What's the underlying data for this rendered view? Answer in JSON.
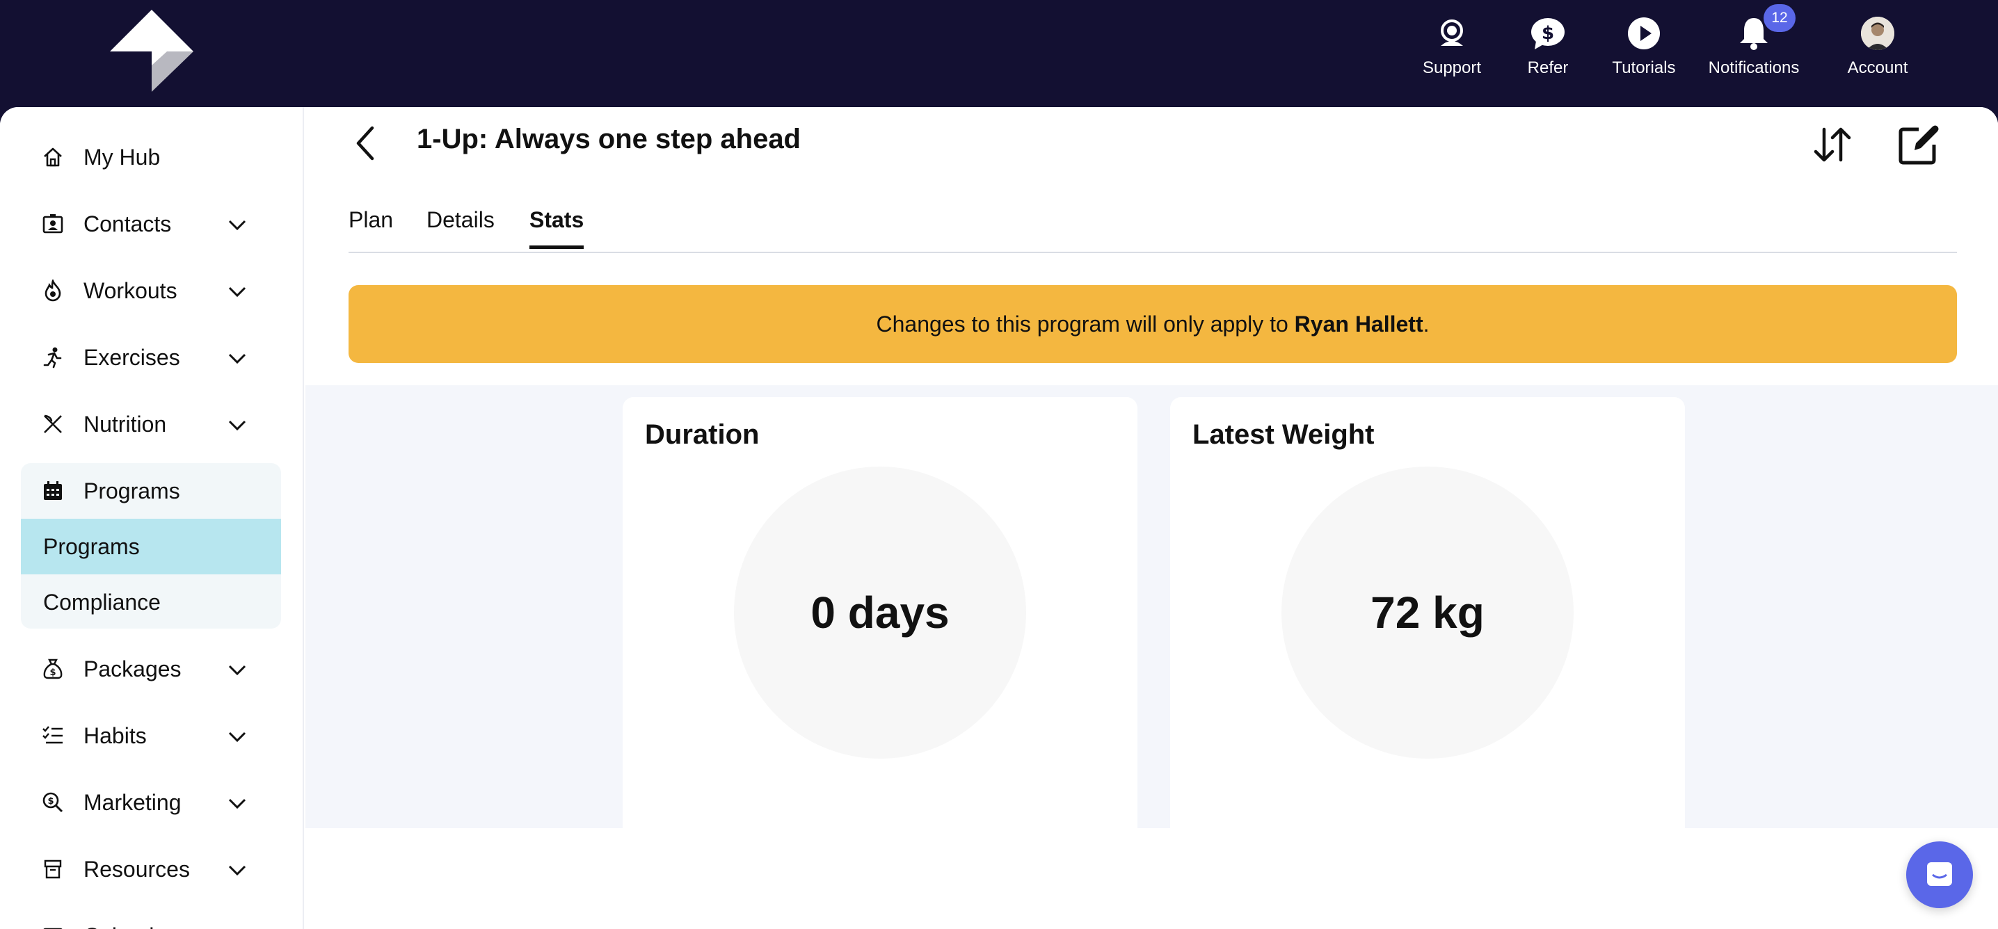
{
  "topnav": {
    "items": [
      {
        "label": "Support",
        "icon": "support-icon"
      },
      {
        "label": "Refer",
        "icon": "dollar-icon"
      },
      {
        "label": "Tutorials",
        "icon": "play-icon"
      },
      {
        "label": "Notifications",
        "icon": "bell-icon",
        "badge": "12"
      },
      {
        "label": "Account",
        "icon": "avatar"
      }
    ]
  },
  "sidebar": {
    "items": [
      {
        "label": "My Hub",
        "icon": "home-icon"
      },
      {
        "label": "Contacts",
        "icon": "contacts-icon"
      },
      {
        "label": "Workouts",
        "icon": "flame-icon"
      },
      {
        "label": "Exercises",
        "icon": "running-icon"
      },
      {
        "label": "Nutrition",
        "icon": "utensils-icon"
      },
      {
        "label": "Programs",
        "icon": "calendar-icon"
      },
      {
        "label": "Packages",
        "icon": "money-bag-icon"
      },
      {
        "label": "Habits",
        "icon": "checklist-icon"
      },
      {
        "label": "Marketing",
        "icon": "search-dollar-icon"
      },
      {
        "label": "Resources",
        "icon": "box-icon"
      },
      {
        "label": "Calendar",
        "icon": "calendar-icon"
      }
    ],
    "programs_sub": [
      "Programs",
      "Compliance"
    ]
  },
  "page": {
    "title": "1-Up: Always one step ahead",
    "tabs": [
      "Plan",
      "Details",
      "Stats"
    ],
    "active_tab": "Stats"
  },
  "banner": {
    "prefix": "Changes to this program will only apply to ",
    "name": "Ryan Hallett",
    "suffix": "."
  },
  "stats": [
    {
      "title": "Duration",
      "value": "0 days"
    },
    {
      "title": "Latest Weight",
      "value": "72 kg"
    }
  ],
  "colors": {
    "topbar": "#131032",
    "accent": "#5a67e8",
    "banner": "#f4b740",
    "active_sub": "#b7e6ef"
  }
}
